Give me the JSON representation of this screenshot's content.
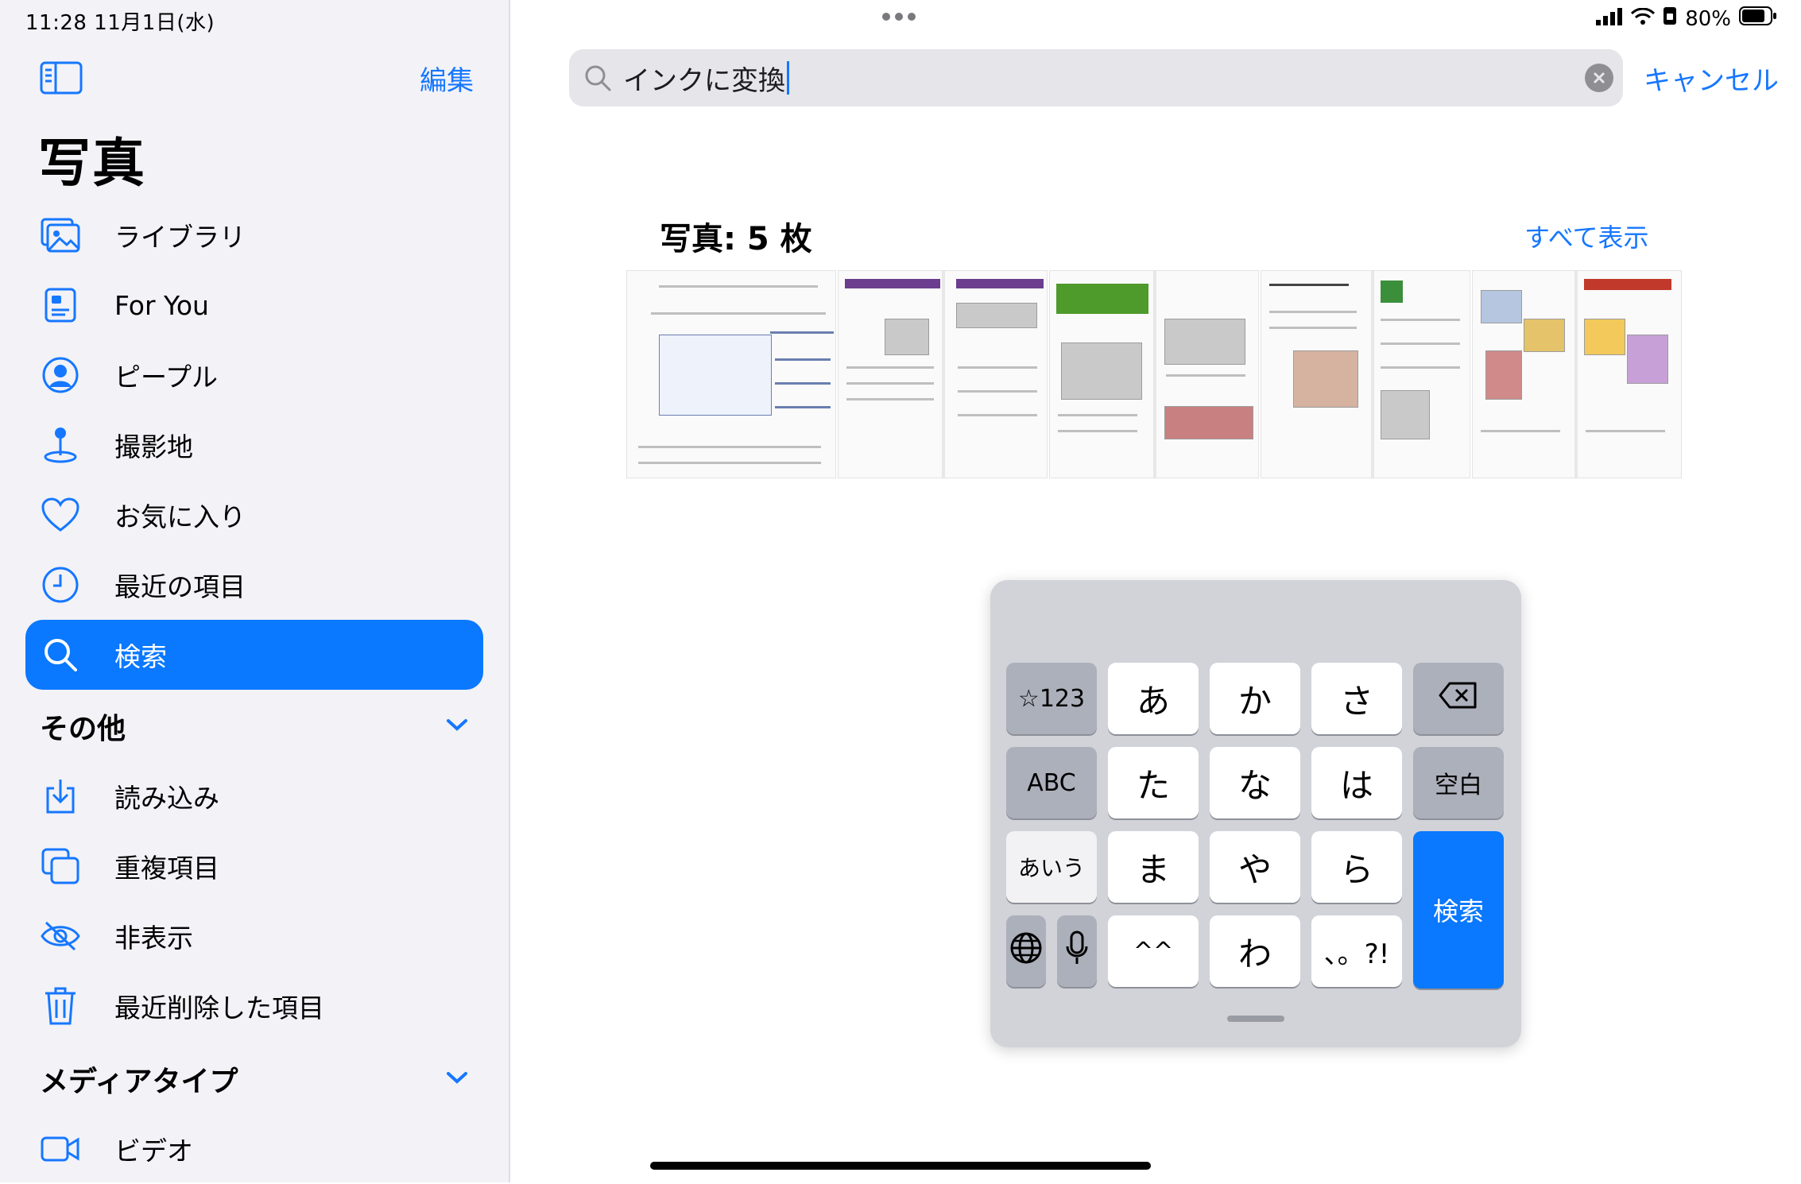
{
  "status": {
    "time_date": "11:28  11月1日(水)",
    "battery": "80%"
  },
  "sidebar": {
    "edit_label": "編集",
    "title": "写真",
    "items": [
      {
        "label": "ライブラリ",
        "icon": "photo-library-icon"
      },
      {
        "label": "For You",
        "icon": "for-you-icon"
      },
      {
        "label": "ピープル",
        "icon": "person-circle-icon"
      },
      {
        "label": "撮影地",
        "icon": "map-pin-icon"
      },
      {
        "label": "お気に入り",
        "icon": "heart-icon"
      },
      {
        "label": "最近の項目",
        "icon": "clock-icon"
      },
      {
        "label": "検索",
        "icon": "search-icon",
        "active": true
      }
    ],
    "section_other": {
      "title": "その他",
      "items": [
        {
          "label": "読み込み",
          "icon": "import-icon"
        },
        {
          "label": "重複項目",
          "icon": "duplicate-icon"
        },
        {
          "label": "非表示",
          "icon": "eye-slash-icon"
        },
        {
          "label": "最近削除した項目",
          "icon": "trash-icon"
        }
      ]
    },
    "section_media": {
      "title": "メディアタイプ",
      "items": [
        {
          "label": "ビデオ",
          "icon": "video-icon"
        }
      ]
    }
  },
  "search": {
    "query": "インクに変換",
    "cancel_label": "キャンセル"
  },
  "results": {
    "title": "写真: 5 枚",
    "see_all_label": "すべて表示"
  },
  "keyboard": {
    "rows": [
      [
        "☆123",
        "あ",
        "か",
        "さ",
        "⌫"
      ],
      [
        "ABC",
        "た",
        "な",
        "は",
        "空白"
      ],
      [
        "あいう",
        "ま",
        "や",
        "ら"
      ],
      [
        "🌐",
        "mic",
        "^^",
        "わ",
        "、。?!"
      ]
    ],
    "search_label": "検索",
    "accent": "#0a78ff"
  }
}
